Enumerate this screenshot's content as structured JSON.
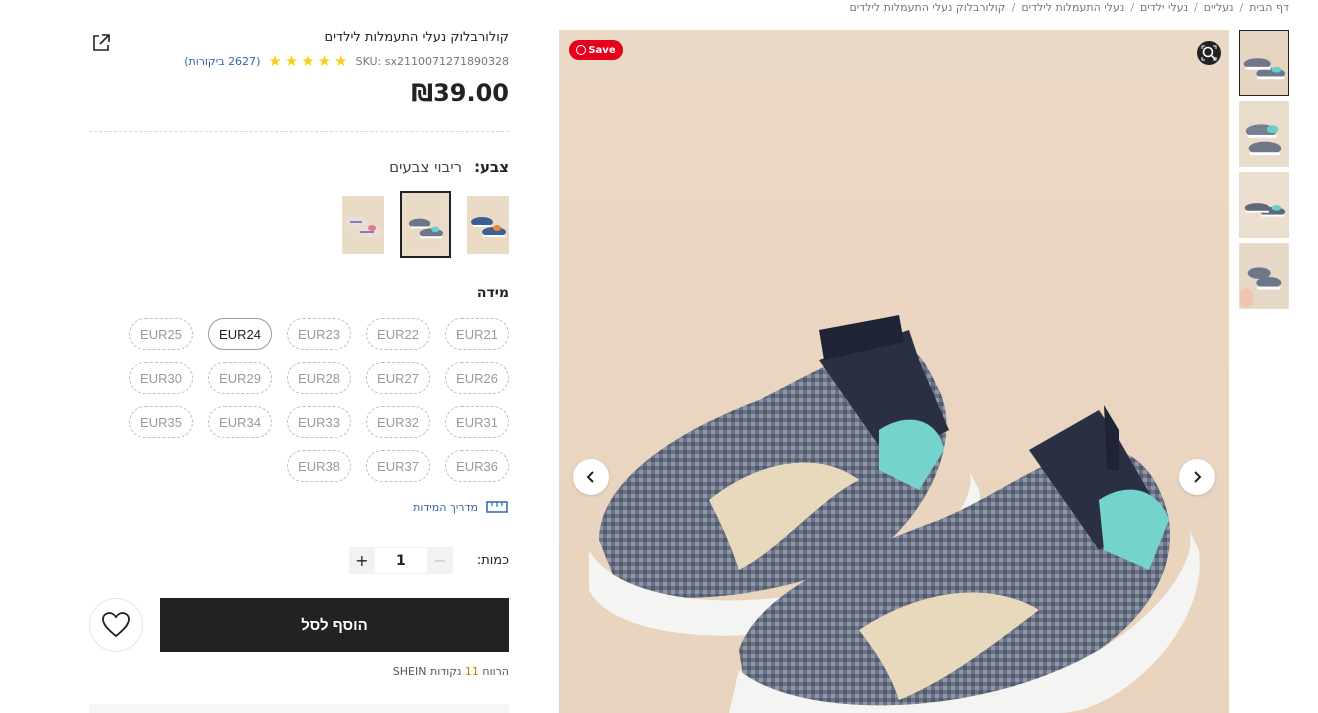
{
  "breadcrumb": {
    "items": [
      "דף הבית",
      "נעליים",
      "נעלי ילדים",
      "נעלי התעמלות לילדים",
      "קולורבלוק נעלי התעמלות לילדים"
    ]
  },
  "product": {
    "title": "קולורבלוק נעלי התעמלות לילדים",
    "sku": "SKU: sx2110071271890328",
    "rating_stars": 5,
    "reviews": "(2627 ביקורות)",
    "price": "₪39.00"
  },
  "color": {
    "label": "צבע:",
    "value": "ריבוי צבעים",
    "selected_index": 1
  },
  "size": {
    "label": "מידה",
    "options": [
      "EUR21",
      "EUR22",
      "EUR23",
      "EUR24",
      "EUR25",
      "EUR26",
      "EUR27",
      "EUR28",
      "EUR29",
      "EUR30",
      "EUR31",
      "EUR32",
      "EUR33",
      "EUR34",
      "EUR35",
      "EUR36",
      "EUR37",
      "EUR38"
    ],
    "available": [
      "EUR24"
    ],
    "guide": "מדריך המידות"
  },
  "quantity": {
    "label": "כמות:",
    "value": "1",
    "minus": "−",
    "plus": "+"
  },
  "actions": {
    "add_to_cart": "הוסף לסל"
  },
  "points": {
    "prefix": "הרווח",
    "value": "11",
    "suffix": "נקודות SHEIN"
  },
  "image": {
    "save_badge": "Save"
  },
  "colors": {
    "accent_dark": "#222222",
    "save_red": "#e5001e",
    "star_yellow": "#facf19",
    "link_blue": "#2d68a8"
  },
  "icons": [
    "share-icon",
    "star-icon",
    "ruler-icon",
    "heart-icon",
    "zoom-icon",
    "chevron-left-icon",
    "chevron-right-icon"
  ]
}
